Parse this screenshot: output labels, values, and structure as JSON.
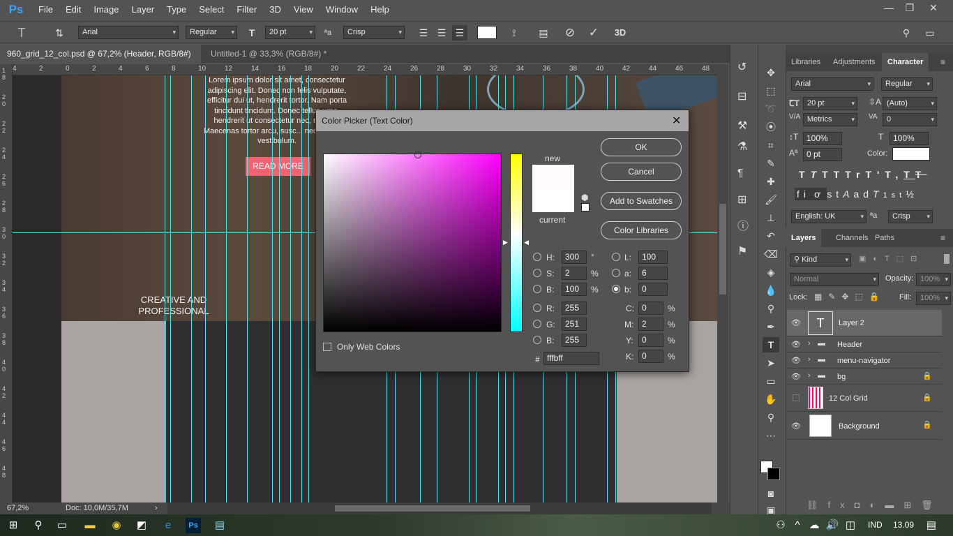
{
  "app": {
    "logo": "Ps",
    "menu": [
      "File",
      "Edit",
      "Image",
      "Layer",
      "Type",
      "Select",
      "Filter",
      "3D",
      "View",
      "Window",
      "Help"
    ],
    "window_controls": [
      "—",
      "❐",
      "✕"
    ]
  },
  "options_bar": {
    "font_family": "Arial",
    "font_style": "Regular",
    "font_size": "20 pt",
    "antialias": "Crisp",
    "aa_icon": "ªa",
    "threed_label": "3D"
  },
  "doc_tabs": [
    {
      "label": "960_grid_12_col.psd @ 67,2% (Header, RGB/8#) *",
      "close": "✕"
    },
    {
      "label": "Untitled-1 @ 33,3% (RGB/8#) *",
      "close": "✕"
    }
  ],
  "ruler_top": [
    "4",
    "2",
    "0",
    "2",
    "4",
    "6",
    "8",
    "10",
    "12",
    "14",
    "16",
    "18",
    "20",
    "22",
    "24",
    "26",
    "28",
    "30",
    "32",
    "34",
    "36",
    "38",
    "40",
    "42",
    "44",
    "46",
    "48"
  ],
  "ruler_left": [
    "1 8",
    "2 0",
    "2 2",
    "2 4",
    "2 6",
    "2 8",
    "3 0",
    "3 2",
    "3 4",
    "3 6",
    "3 8",
    "4 0",
    "4 2",
    "4 4",
    "4 6",
    "4 8"
  ],
  "canvas": {
    "lorem": "Lorem ipsum dolor sit amet, consectetur adipiscing elit. Donec non felis vulputate, efficitur dui ut, hendrerit tortor. Nam porta tincidunt tincidunt. Donec tellus urna, hendrerit ut consectetur nec, m... elit. Maecenas tortor arcu, susc... nec, euismod vestibulum.",
    "read_more": "READ MORE",
    "creative": "CREATIVE AND PROFESSIONAL"
  },
  "status": {
    "zoom": "67,2%",
    "doc": "Doc: 10,0M/35,7M"
  },
  "picker": {
    "title": "Color Picker (Text Color)",
    "close": "✕",
    "new_label": "new",
    "current_label": "current",
    "ok": "OK",
    "cancel": "Cancel",
    "add_swatches": "Add to Swatches",
    "color_libraries": "Color Libraries",
    "only_web": "Only Web Colors",
    "hsb": {
      "h_label": "H:",
      "h": "300",
      "h_unit": "°",
      "s_label": "S:",
      "s": "2",
      "s_unit": "%",
      "b_label": "B:",
      "b": "100",
      "b_unit": "%"
    },
    "rgb": {
      "r_label": "R:",
      "r": "255",
      "g_label": "G:",
      "g": "251",
      "b_label": "B:",
      "b": "255"
    },
    "lab": {
      "l_label": "L:",
      "l": "100",
      "a_label": "a:",
      "a": "6",
      "b_label": "b:",
      "b": "0"
    },
    "cmyk": {
      "c_label": "C:",
      "c": "0",
      "m_label": "M:",
      "m": "2",
      "y_label": "Y:",
      "y": "0",
      "k_label": "K:",
      "k": "0",
      "unit": "%"
    },
    "hex_label": "#",
    "hex": "fffbff",
    "new_color": "#fffbff",
    "current_color": "#ffffff",
    "hue_color": "#ff00ff"
  },
  "panels": {
    "top_tabs": [
      "Libraries",
      "Adjustments",
      "Character"
    ],
    "character": {
      "font": "Arial",
      "style": "Regular",
      "size": "20 pt",
      "leading": "(Auto)",
      "kerning": "Metrics",
      "tracking": "0",
      "vscale": "100%",
      "hscale": "100%",
      "baseline": "0 pt",
      "color_label": "Color:",
      "language": "English: UK",
      "antialias": "Crisp",
      "aa_icon": "ªa",
      "type_buttons": [
        "T",
        "T",
        "TT",
        "Tr",
        "T'",
        "T,",
        "T",
        "T"
      ],
      "glyph_buttons": [
        "fi",
        "ơ",
        "st",
        "A",
        "ad",
        "T",
        "1st",
        "½"
      ]
    },
    "layers_tabs": [
      "Layers",
      "Channels",
      "Paths"
    ],
    "layers": {
      "kind": "Kind",
      "blend": "Normal",
      "opacity_label": "Opacity:",
      "opacity": "100%",
      "lock_label": "Lock:",
      "fill_label": "Fill:",
      "fill": "100%",
      "items": [
        {
          "name": "Layer 2",
          "type": "text",
          "visible": true,
          "locked": false
        },
        {
          "name": "Header",
          "type": "group",
          "visible": true,
          "locked": false
        },
        {
          "name": "menu-navigator",
          "type": "group",
          "visible": true,
          "locked": false
        },
        {
          "name": "bg",
          "type": "group",
          "visible": true,
          "locked": true
        },
        {
          "name": "12 Col Grid",
          "type": "image",
          "visible": false,
          "locked": true
        },
        {
          "name": "Background",
          "type": "image",
          "visible": true,
          "locked": true
        }
      ]
    }
  },
  "taskbar": {
    "lang": "IND",
    "time": "13.09"
  }
}
